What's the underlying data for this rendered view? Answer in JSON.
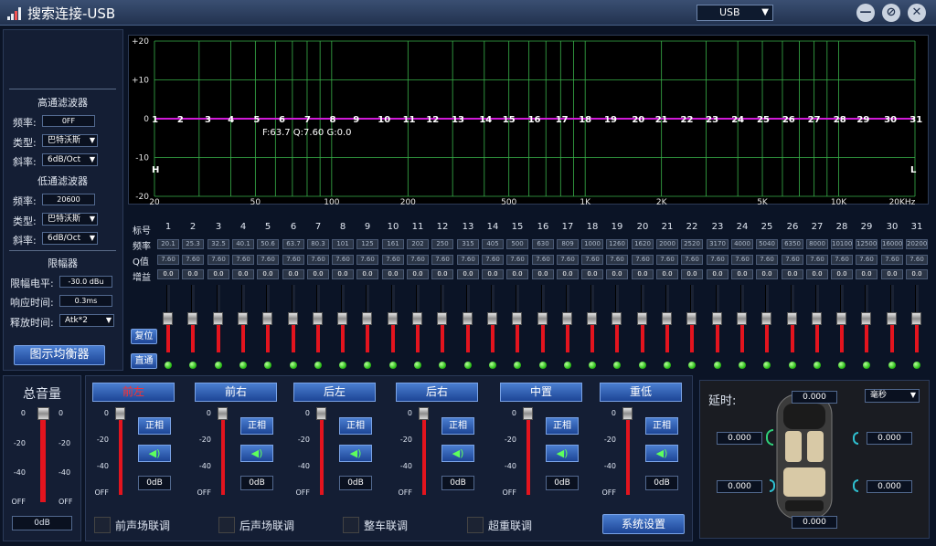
{
  "title": "搜索连接-USB",
  "device_select": "USB",
  "window_buttons": [
    "minimize-icon",
    "settings-icon",
    "close-icon"
  ],
  "hpf": {
    "heading": "高通滤波器",
    "freq_label": "频率:",
    "freq_value": "0FF",
    "type_label": "类型:",
    "type_value": "巴特沃斯",
    "slope_label": "斜率:",
    "slope_value": "6dB/Oct"
  },
  "lpf": {
    "heading": "低通滤波器",
    "freq_label": "频率:",
    "freq_value": "20600",
    "type_label": "类型:",
    "type_value": "巴特沃斯",
    "slope_label": "斜率:",
    "slope_value": "6dB/Oct"
  },
  "limiter": {
    "heading": "限幅器",
    "level_label": "限幅电平:",
    "level_value": "-30.0 dBu",
    "response_label": "响应时间:",
    "response_value": "0.3ms",
    "release_label": "释放时间:",
    "release_value": "Atk*2"
  },
  "eq_button": "图示均衡器",
  "reset_button": "复位",
  "bypass_button": "直通",
  "graph": {
    "y_ticks": [
      "+20",
      "+10",
      "0",
      "-10",
      "-20"
    ],
    "x_ticks": [
      "20",
      "50",
      "100",
      "200",
      "500",
      "1K",
      "2K",
      "5K",
      "10K",
      "20KHz"
    ],
    "readout": "F:63.7 Q:7.60 G:0.0",
    "h_marker": "H",
    "l_marker": "L",
    "curve_color": "#d01ad8",
    "grid_color": "#39b24a"
  },
  "eq_rows": {
    "label_row": "标号",
    "freq_row": "频率",
    "q_row": "Q值",
    "gain_row": "增益"
  },
  "eq_bands": [
    {
      "n": "1",
      "f": "20.1",
      "q": "7.60",
      "g": "0.0"
    },
    {
      "n": "2",
      "f": "25.3",
      "q": "7.60",
      "g": "0.0"
    },
    {
      "n": "3",
      "f": "32.5",
      "q": "7.60",
      "g": "0.0"
    },
    {
      "n": "4",
      "f": "40.1",
      "q": "7.60",
      "g": "0.0"
    },
    {
      "n": "5",
      "f": "50.6",
      "q": "7.60",
      "g": "0.0"
    },
    {
      "n": "6",
      "f": "63.7",
      "q": "7.60",
      "g": "0.0"
    },
    {
      "n": "7",
      "f": "80.3",
      "q": "7.60",
      "g": "0.0"
    },
    {
      "n": "8",
      "f": "101",
      "q": "7.60",
      "g": "0.0"
    },
    {
      "n": "9",
      "f": "125",
      "q": "7.60",
      "g": "0.0"
    },
    {
      "n": "10",
      "f": "161",
      "q": "7.60",
      "g": "0.0"
    },
    {
      "n": "11",
      "f": "202",
      "q": "7.60",
      "g": "0.0"
    },
    {
      "n": "12",
      "f": "250",
      "q": "7.60",
      "g": "0.0"
    },
    {
      "n": "13",
      "f": "315",
      "q": "7.60",
      "g": "0.0"
    },
    {
      "n": "14",
      "f": "405",
      "q": "7.60",
      "g": "0.0"
    },
    {
      "n": "15",
      "f": "500",
      "q": "7.60",
      "g": "0.0"
    },
    {
      "n": "16",
      "f": "630",
      "q": "7.60",
      "g": "0.0"
    },
    {
      "n": "17",
      "f": "809",
      "q": "7.60",
      "g": "0.0"
    },
    {
      "n": "18",
      "f": "1000",
      "q": "7.60",
      "g": "0.0"
    },
    {
      "n": "19",
      "f": "1260",
      "q": "7.60",
      "g": "0.0"
    },
    {
      "n": "20",
      "f": "1620",
      "q": "7.60",
      "g": "0.0"
    },
    {
      "n": "21",
      "f": "2000",
      "q": "7.60",
      "g": "0.0"
    },
    {
      "n": "22",
      "f": "2520",
      "q": "7.60",
      "g": "0.0"
    },
    {
      "n": "23",
      "f": "3170",
      "q": "7.60",
      "g": "0.0"
    },
    {
      "n": "24",
      "f": "4000",
      "q": "7.60",
      "g": "0.0"
    },
    {
      "n": "25",
      "f": "5040",
      "q": "7.60",
      "g": "0.0"
    },
    {
      "n": "26",
      "f": "6350",
      "q": "7.60",
      "g": "0.0"
    },
    {
      "n": "27",
      "f": "8000",
      "q": "7.60",
      "g": "0.0"
    },
    {
      "n": "28",
      "f": "10100",
      "q": "7.60",
      "g": "0.0"
    },
    {
      "n": "29",
      "f": "12500",
      "q": "7.60",
      "g": "0.0"
    },
    {
      "n": "30",
      "f": "16000",
      "q": "7.60",
      "g": "0.0"
    },
    {
      "n": "31",
      "f": "20200",
      "q": "7.60",
      "g": "0.0"
    }
  ],
  "master": {
    "label": "总音量",
    "value": "0dB",
    "scale_left": [
      "0",
      "-20",
      "-40",
      "OFF"
    ],
    "scale_right": [
      "0",
      "-20",
      "-40",
      "OFF"
    ]
  },
  "channels": [
    {
      "name": "前左",
      "phase": "正相",
      "gain": "0dB",
      "active": true
    },
    {
      "name": "前右",
      "phase": "正相",
      "gain": "0dB",
      "active": false
    },
    {
      "name": "后左",
      "phase": "正相",
      "gain": "0dB",
      "active": false
    },
    {
      "name": "后右",
      "phase": "正相",
      "gain": "0dB",
      "active": false
    },
    {
      "name": "中置",
      "phase": "正相",
      "gain": "0dB",
      "active": false
    },
    {
      "name": "重低",
      "phase": "正相",
      "gain": "0dB",
      "active": false
    }
  ],
  "channel_scale": [
    "0",
    "-20",
    "-40",
    "OFF"
  ],
  "links": [
    "前声场联调",
    "后声场联调",
    "整车联调",
    "超重联调"
  ],
  "system_button": "系统设置",
  "delay": {
    "label": "延时:",
    "unit": "毫秒",
    "top": "0.000",
    "front_left": "0.000",
    "front_right": "0.000",
    "rear_left": "0.000",
    "rear_right": "0.000",
    "bottom": "0.000"
  }
}
